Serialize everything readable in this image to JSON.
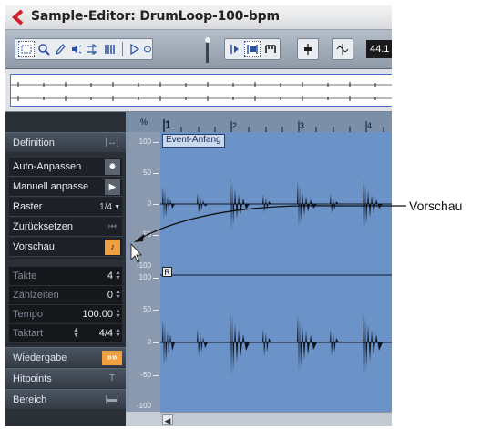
{
  "window": {
    "title": "Sample-Editor: DrumLoop-100-bpm"
  },
  "toolbar": {
    "readout": "44.1",
    "tools": [
      "select-range-icon",
      "zoom-icon",
      "pencil-icon",
      "play-icon",
      "scrub-icon",
      "hitpoint-icon",
      "audition-icon",
      "loop-icon",
      "snap-icon",
      "auto-scroll-icon",
      "marker-icon",
      "level-icon",
      "snap-to-zero-icon"
    ]
  },
  "sidebar": {
    "definition": "Definition",
    "auto_anpassen": "Auto-Anpassen",
    "manuell_anpassen": "Manuell anpasse",
    "raster_label": "Raster",
    "raster_value": "1/4",
    "zuruecksetzen": "Zurücksetzen",
    "vorschau": "Vorschau",
    "takte_label": "Takte",
    "takte_value": "4",
    "zaehlzeiten_label": "Zählzeiten",
    "zaehlzeiten_value": "0",
    "tempo_label": "Tempo",
    "tempo_value": "100.00",
    "taktart_label": "Taktart",
    "taktart_value": "4/4",
    "wiedergabe": "Wiedergabe",
    "hitpoints": "Hitpoints",
    "bereich": "Bereich"
  },
  "ruler": {
    "unit": "%",
    "bars": [
      "1",
      "2",
      "3",
      "4"
    ]
  },
  "scale": {
    "labels": [
      "100",
      "50",
      "0",
      "50",
      "-100",
      "100",
      "50",
      "0",
      "-50",
      "-100"
    ]
  },
  "editor": {
    "event_start_label": "Event-Anfang",
    "right_channel_marker": "R"
  },
  "annotation": {
    "label": "Vorschau"
  },
  "colors": {
    "waveform_bg": "#6b93c8",
    "sidebar_bg": "#1d2026",
    "accent_orange": "#f0a040"
  }
}
